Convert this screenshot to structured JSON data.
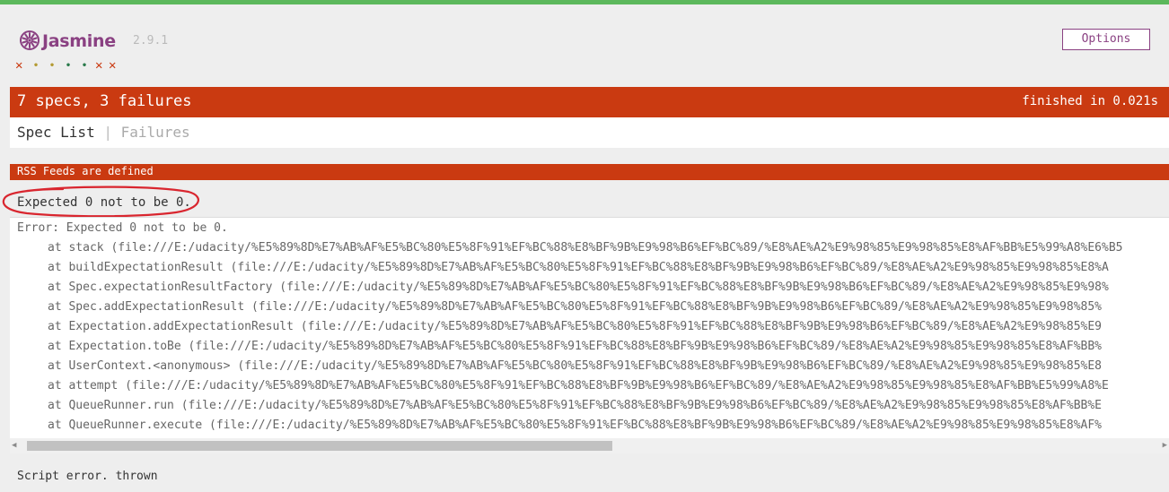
{
  "header": {
    "brand": "Jasmine",
    "version": "2.9.1",
    "options_label": "Options"
  },
  "spec_symbols": [
    {
      "kind": "failed",
      "glyph": "✕",
      "color": "#ca3a11"
    },
    {
      "kind": "passed",
      "glyph": "•",
      "color": "#b49b33"
    },
    {
      "kind": "passed",
      "glyph": "•",
      "color": "#b49b33"
    },
    {
      "kind": "passed",
      "glyph": "•",
      "color": "#2a7a4b"
    },
    {
      "kind": "passed",
      "glyph": "•",
      "color": "#2a7a4b"
    },
    {
      "kind": "failed",
      "glyph": "✕",
      "color": "#ca3a11"
    },
    {
      "kind": "failed",
      "glyph": "✕",
      "color": "#ca3a11"
    }
  ],
  "summary": {
    "overall": "7 specs, 3 failures",
    "duration": "finished in 0.021s"
  },
  "menu": {
    "spec_list": "Spec List",
    "separator": "|",
    "failures": "Failures"
  },
  "failure": {
    "suite": "RSS Feeds are defined",
    "message": "Expected 0 not to be 0.",
    "stack": [
      "Error: Expected 0 not to be 0.",
      "at stack (file:///E:/udacity/%E5%89%8D%E7%AB%AF%E5%BC%80%E5%8F%91%EF%BC%88%E8%BF%9B%E9%98%B6%EF%BC%89/%E8%AE%A2%E9%98%85%E9%98%85%E8%AF%BB%E5%99%A8%E6%B5",
      "at buildExpectationResult (file:///E:/udacity/%E5%89%8D%E7%AB%AF%E5%BC%80%E5%8F%91%EF%BC%88%E8%BF%9B%E9%98%B6%EF%BC%89/%E8%AE%A2%E9%98%85%E9%98%85%E8%A",
      "at Spec.expectationResultFactory (file:///E:/udacity/%E5%89%8D%E7%AB%AF%E5%BC%80%E5%8F%91%EF%BC%88%E8%BF%9B%E9%98%B6%EF%BC%89/%E8%AE%A2%E9%98%85%E9%98%",
      "at Spec.addExpectationResult (file:///E:/udacity/%E5%89%8D%E7%AB%AF%E5%BC%80%E5%8F%91%EF%BC%88%E8%BF%9B%E9%98%B6%EF%BC%89/%E8%AE%A2%E9%98%85%E9%98%85%",
      "at Expectation.addExpectationResult (file:///E:/udacity/%E5%89%8D%E7%AB%AF%E5%BC%80%E5%8F%91%EF%BC%88%E8%BF%9B%E9%98%B6%EF%BC%89/%E8%AE%A2%E9%98%85%E9",
      "at Expectation.toBe (file:///E:/udacity/%E5%89%8D%E7%AB%AF%E5%BC%80%E5%8F%91%EF%BC%88%E8%BF%9B%E9%98%B6%EF%BC%89/%E8%AE%A2%E9%98%85%E9%98%85%E8%AF%BB%",
      "at UserContext.<anonymous> (file:///E:/udacity/%E5%89%8D%E7%AB%AF%E5%BC%80%E5%8F%91%EF%BC%88%E8%BF%9B%E9%98%B6%EF%BC%89/%E8%AE%A2%E9%98%85%E9%98%85%E8",
      "at attempt (file:///E:/udacity/%E5%89%8D%E7%AB%AF%E5%BC%80%E5%8F%91%EF%BC%88%E8%BF%9B%E9%98%B6%EF%BC%89/%E8%AE%A2%E9%98%85%E9%98%85%E8%AF%BB%E5%99%A8%E",
      "at QueueRunner.run (file:///E:/udacity/%E5%89%8D%E7%AB%AF%E5%BC%80%E5%8F%91%EF%BC%88%E8%BF%9B%E9%98%B6%EF%BC%89/%E8%AE%A2%E9%98%85%E9%98%85%E8%AF%BB%E",
      "at QueueRunner.execute (file:///E:/udacity/%E5%89%8D%E7%AB%AF%E5%BC%80%E5%8F%91%EF%BC%88%E8%BF%9B%E9%98%B6%EF%BC%89/%E8%AE%A2%E9%98%85%E9%98%85%E8%AF%"
    ],
    "script_error": "Script error. thrown"
  },
  "colors": {
    "success_bar": "#5cb85c",
    "failure": "#ca3a11",
    "brand": "#8a4182",
    "annotation": "#d9262f"
  },
  "icons": {
    "logo": "jasmine-flower-icon",
    "scroll_left": "scroll-left-arrow-icon",
    "scroll_right": "scroll-right-arrow-icon"
  }
}
